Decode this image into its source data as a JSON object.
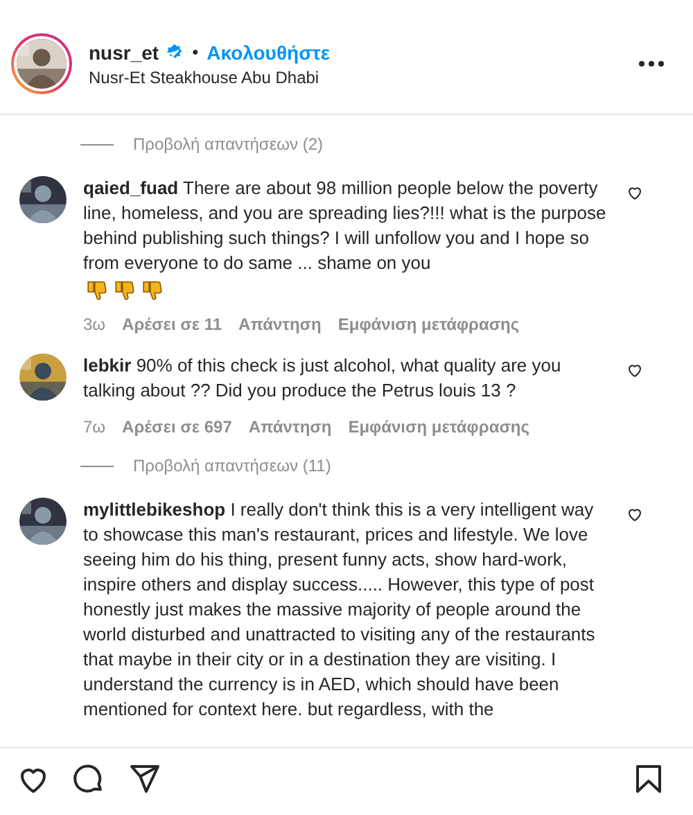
{
  "header": {
    "username": "nusr_et",
    "verified": true,
    "separator": "•",
    "follow": "Ακολουθήστε",
    "location": "Nusr-Et Steakhouse Abu Dhabi",
    "has_story": true
  },
  "comments": [
    {
      "kind": "replies",
      "label": "Προβολή απαντήσεων (2)"
    },
    {
      "kind": "comment",
      "username": "qaied_fuad",
      "text": "There are about 98 million people below the poverty line, homeless, and you are spreading lies?!!! what is the purpose behind publishing such things? I will unfollow you and I hope so from everyone to do same ... shame on you",
      "trailing_icons": [
        {
          "kind": "thumbs-down"
        },
        {
          "kind": "thumbs-down"
        },
        {
          "kind": "thumbs-down"
        }
      ],
      "liked": false,
      "time": "3ω",
      "likes": "Αρέσει σε 11",
      "reply": "Απάντηση",
      "translate": "Εμφάνιση μετάφρασης"
    },
    {
      "kind": "comment",
      "username": "lebkir",
      "text": "90% of this check is just alcohol, what quality are you talking about ?? Did you produce the Petrus louis 13 ?",
      "liked": false,
      "time": "7ω",
      "likes": "Αρέσει σε 697",
      "reply": "Απάντηση",
      "translate": "Εμφάνιση μετάφρασης"
    },
    {
      "kind": "replies",
      "label": "Προβολή απαντήσεων (11)"
    },
    {
      "kind": "comment",
      "username": "mylittlebikeshop",
      "text": "I really don't think this is a very intelligent way to showcase this man's restaurant, prices and lifestyle. We love seeing him do his thing, present funny acts, show hard-work, inspire others and display success..... However, this type of post honestly just makes the massive majority of people around the world disturbed and unattracted to visiting any of the restaurants that maybe in their city or in a destination they are visiting. I understand the currency is in AED, which should have been mentioned for context here. but regardless, with the",
      "liked": false
    }
  ],
  "actions": {
    "liked": false,
    "saved": false
  }
}
